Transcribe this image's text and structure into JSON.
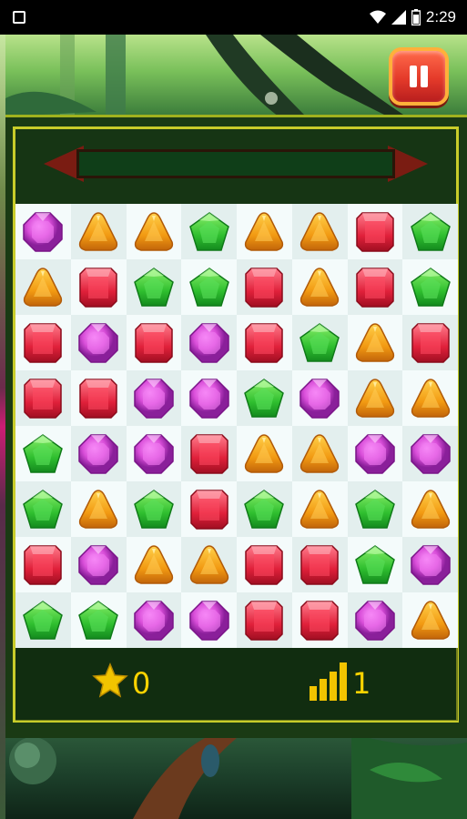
{
  "status_bar": {
    "time": "2:29",
    "icons": [
      "wifi-icon",
      "signal-icon",
      "battery-icon"
    ]
  },
  "hud": {
    "score": "0",
    "level": "1",
    "score_icon": "star-icon",
    "level_icon": "level-bars-icon",
    "pause_icon": "pause-icon",
    "progress_fraction": 0
  },
  "colors": {
    "accent_yellow": "#ffd400",
    "pause_red": "#e43a2a",
    "frame_yellow": "#c8cc2a"
  },
  "board": {
    "rows": 8,
    "cols": 8,
    "gem_types": [
      "purple-octagon-gem",
      "orange-triangle-gem",
      "green-pentagon-gem",
      "red-square-gem"
    ],
    "grid": [
      [
        "purple",
        "orange",
        "orange",
        "green",
        "orange",
        "orange",
        "red",
        "green"
      ],
      [
        "orange",
        "red",
        "green",
        "green",
        "red",
        "orange",
        "red",
        "green"
      ],
      [
        "red",
        "purple",
        "red",
        "purple",
        "red",
        "green",
        "orange",
        "red"
      ],
      [
        "red",
        "red",
        "purple",
        "purple",
        "green",
        "purple",
        "orange",
        "orange"
      ],
      [
        "green",
        "purple",
        "purple",
        "red",
        "orange",
        "orange",
        "purple",
        "purple"
      ],
      [
        "green",
        "orange",
        "green",
        "red",
        "green",
        "orange",
        "green",
        "orange"
      ],
      [
        "red",
        "purple",
        "orange",
        "orange",
        "red",
        "red",
        "green",
        "purple"
      ],
      [
        "green",
        "green",
        "purple",
        "purple",
        "red",
        "red",
        "purple",
        "orange"
      ]
    ]
  }
}
